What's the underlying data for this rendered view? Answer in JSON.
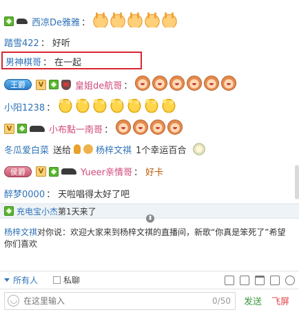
{
  "chat": {
    "messages": [
      {
        "user": "西凉De雅雅",
        "sep": "：",
        "emoji": [
          "hand",
          "hand",
          "hand",
          "hand",
          "hand"
        ]
      },
      {
        "user": "踏雪422",
        "sep": "：",
        "text": "好听"
      },
      {
        "user": "男神棋哥",
        "sep": "：",
        "text": "在一起"
      },
      {
        "rank": "王爵",
        "user": "皇姐de航哥",
        "sep": "：",
        "emoji": [
          "face",
          "face",
          "face",
          "face",
          "face",
          "face"
        ]
      },
      {
        "user": "小阳1238",
        "sep": "：",
        "emoji": [
          "clap",
          "clap",
          "clap",
          "clap",
          "clap",
          "clap",
          "clap"
        ]
      },
      {
        "user": "小布點一南哥",
        "sep": "：",
        "emoji": [
          "face",
          "face",
          "face",
          "face"
        ]
      },
      {
        "user": "冬瓜爱白菜",
        "gift_verb": "送给",
        "target": "杨梓文祺",
        "gift_text": "1个幸运百合"
      },
      {
        "rank": "侯爵",
        "user": "Yueer亲情哥",
        "sep": "：",
        "text": "好卡"
      },
      {
        "user": "醉梦0000",
        "sep": "：",
        "text": "天啦唱得太好了吧"
      }
    ]
  },
  "welcome": {
    "user": "充电宝小杰",
    "text": "第1天来了"
  },
  "notice": {
    "who": "杨梓文祺",
    "text": "对你说：欢迎大家来到杨梓文祺的直播间，新歌“你真是笨死了”希望你们喜欢"
  },
  "toolbar": {
    "audience": "所有人",
    "private": "私聊"
  },
  "input": {
    "placeholder": "在这里输入",
    "counter": "0/50",
    "send": "发送",
    "fly": "飞屏"
  },
  "colors": {
    "highlight": "#d9232e",
    "name_blue": "#2f73b8",
    "name_pink": "#d1497b",
    "send": "#3a9a3a",
    "fly": "#e0454a"
  }
}
